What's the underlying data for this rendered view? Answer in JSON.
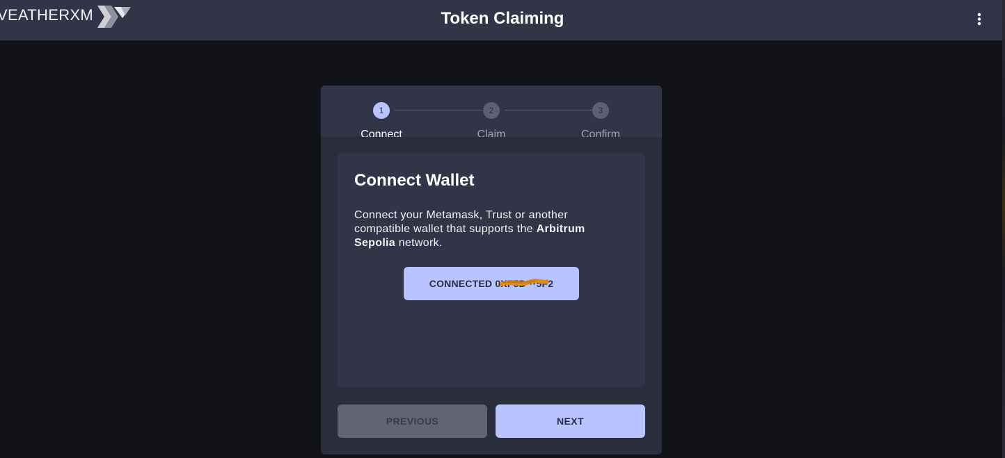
{
  "header": {
    "logo_text": "VEATHERXM",
    "title": "Token Claiming",
    "menu_icon": "more-vertical-icon"
  },
  "stepper": {
    "steps": [
      {
        "number": "1",
        "label": "Connect",
        "active": true
      },
      {
        "number": "2",
        "label": "Claim",
        "active": false
      },
      {
        "number": "3",
        "label": "Confirm",
        "active": false
      }
    ]
  },
  "panel": {
    "title": "Connect Wallet",
    "desc_part1": "Connect your Metamask, Trust or another compatible wallet that supports the ",
    "desc_bold": "Arbitrum Sepolia",
    "desc_part2": " network.",
    "connected_label": "CONNECTED 0XF5D···5F2"
  },
  "nav": {
    "previous_label": "PREVIOUS",
    "next_label": "NEXT"
  },
  "colors": {
    "accent": "#b8c3ff",
    "appbar": "#323547",
    "background": "#121318",
    "redaction": "#e08a1a"
  }
}
